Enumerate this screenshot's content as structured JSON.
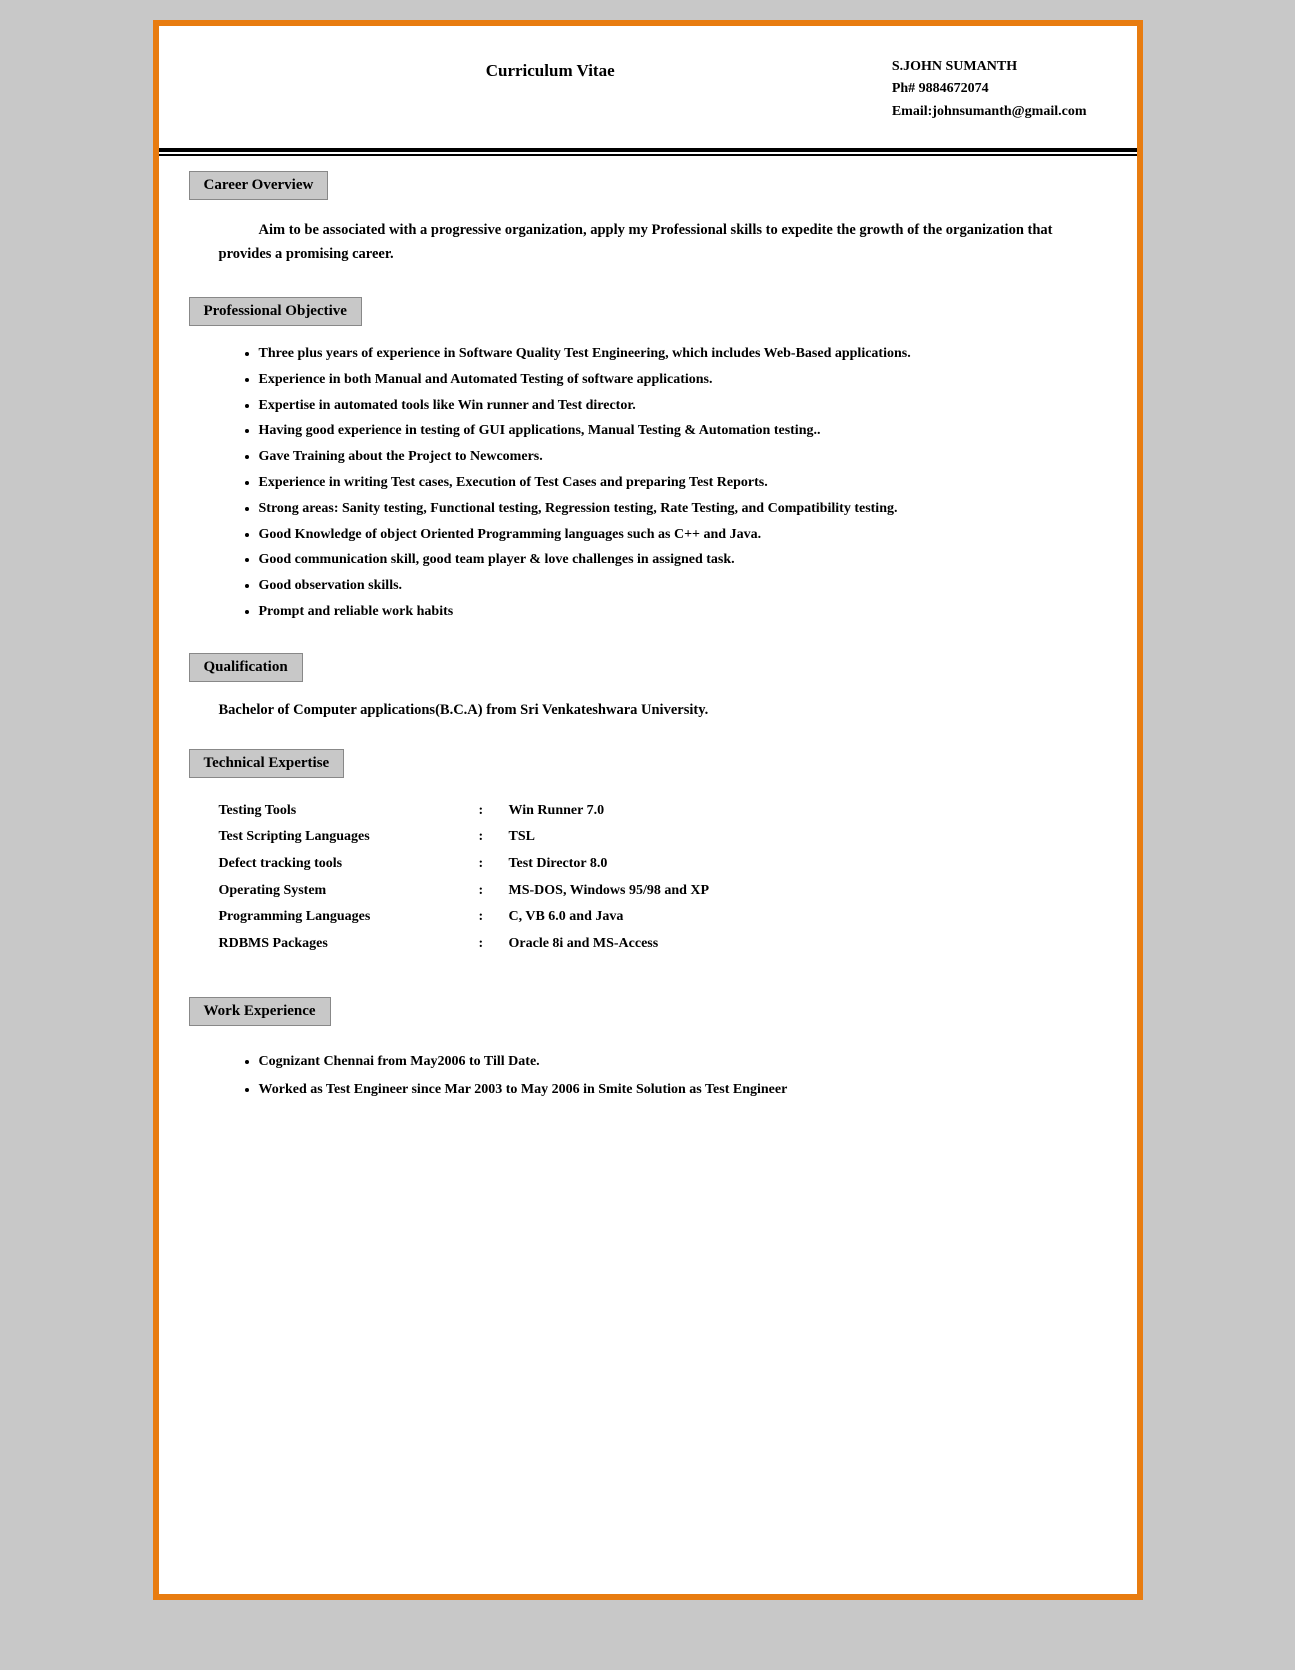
{
  "header": {
    "title": "Curriculum Vitae",
    "name": "S.JOHN SUMANTH",
    "phone": "Ph# 9884672074",
    "email": "Email:johnsumanth@gmail.com"
  },
  "sections": {
    "career_overview": {
      "label": "Career Overview",
      "text": "Aim to be associated with a progressive organization, apply my Professional skills to expedite the growth of the organization that provides a promising career."
    },
    "professional_objective": {
      "label": "Professional Objective",
      "bullets": [
        "Three plus years of experience in Software Quality Test Engineering, which includes Web-Based applications.",
        "Experience in both Manual and Automated Testing of software applications.",
        "Expertise in automated tools like Win runner and Test director.",
        "Having good experience in testing of GUI applications, Manual Testing & Automation testing..",
        "Gave Training about the Project to Newcomers.",
        "Experience in writing Test cases, Execution of Test Cases and preparing Test Reports.",
        "Strong areas: Sanity testing, Functional testing, Regression testing, Rate Testing, and Compatibility testing.",
        "Good Knowledge of object Oriented Programming languages such as C++ and Java.",
        "Good communication skill, good team player & love challenges in assigned task.",
        "Good observation skills.",
        "Prompt and reliable work habits"
      ]
    },
    "qualification": {
      "label": "Qualification",
      "text": "Bachelor of Computer applications(B.C.A)  from Sri Venkateshwara University."
    },
    "technical_expertise": {
      "label": "Technical Expertise",
      "rows": [
        {
          "label": "Testing Tools",
          "colon": ":",
          "value": "Win Runner 7.0"
        },
        {
          "label": "Test Scripting Languages",
          "colon": ":",
          "value": "TSL"
        },
        {
          "label": "Defect tracking tools",
          "colon": ":",
          "value": "Test Director 8.0"
        },
        {
          "label": "Operating System",
          "colon": ":",
          "value": "MS-DOS, Windows 95/98 and XP"
        },
        {
          "label": "Programming Languages",
          "colon": ":",
          "value": "C, VB 6.0 and Java"
        },
        {
          "label": "RDBMS Packages",
          "colon": ":",
          "value": "Oracle 8i and MS-Access"
        }
      ]
    },
    "work_experience": {
      "label": "Work Experience",
      "bullets": [
        "Cognizant Chennai from May2006 to Till Date.",
        "Worked as Test Engineer since Mar 2003 to May 2006 in Smite Solution as Test Engineer"
      ]
    }
  }
}
